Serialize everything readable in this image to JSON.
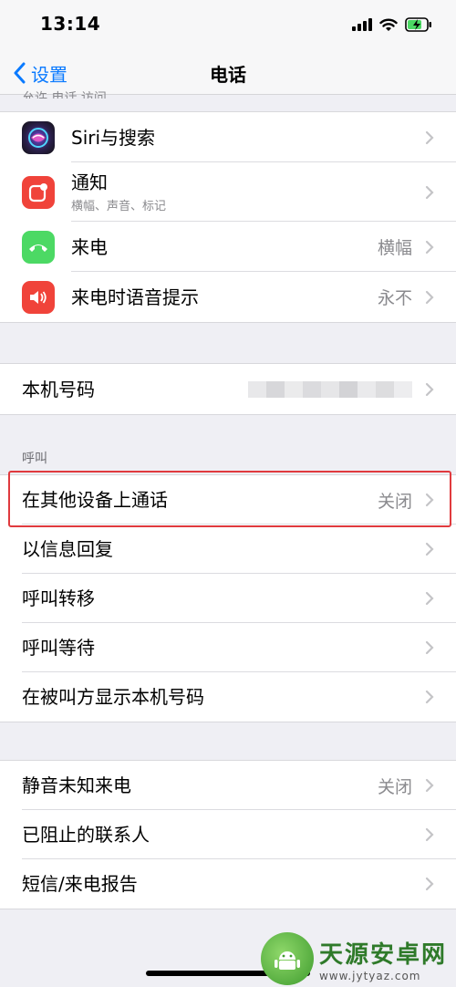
{
  "status_bar": {
    "time": "13:14"
  },
  "nav": {
    "back_label": "设置",
    "title": "电话"
  },
  "peek_header": "允许 电话 访问",
  "group1": [
    {
      "label": "Siri与搜索",
      "sub": "",
      "value": "",
      "icon": "siri-icon",
      "color": "#2b2b3b"
    },
    {
      "label": "通知",
      "sub": "横幅、声音、标记",
      "value": "",
      "icon": "notification-icon",
      "color": "#f0433a"
    },
    {
      "label": "来电",
      "sub": "",
      "value": "横幅",
      "icon": "phone-icon",
      "color": "#4cd964"
    },
    {
      "label": "来电时语音提示",
      "sub": "",
      "value": "永不",
      "icon": "speaker-icon",
      "color": "#f0433a"
    }
  ],
  "group2": [
    {
      "label": "本机号码"
    }
  ],
  "calls_header": "呼叫",
  "group3": [
    {
      "label": "在其他设备上通话",
      "value": "关闭"
    },
    {
      "label": "以信息回复",
      "value": ""
    },
    {
      "label": "呼叫转移",
      "value": ""
    },
    {
      "label": "呼叫等待",
      "value": ""
    },
    {
      "label": "在被叫方显示本机号码",
      "value": ""
    }
  ],
  "group4": [
    {
      "label": "静音未知来电",
      "value": "关闭"
    },
    {
      "label": "已阻止的联系人",
      "value": ""
    },
    {
      "label": "短信/来电报告",
      "value": ""
    }
  ],
  "watermark": {
    "title": "天源安卓网",
    "url": "www.jytyaz.com"
  }
}
